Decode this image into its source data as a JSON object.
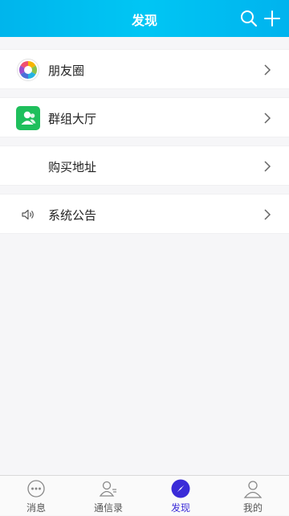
{
  "header": {
    "title": "发现"
  },
  "menu": [
    {
      "label": "朋友圈"
    },
    {
      "label": "群组大厅"
    },
    {
      "label": "购买地址"
    },
    {
      "label": "系统公告"
    }
  ],
  "tabs": [
    {
      "label": "消息"
    },
    {
      "label": "通信录"
    },
    {
      "label": "发现"
    },
    {
      "label": "我的"
    }
  ],
  "colors": {
    "header_start": "#00b5ec",
    "header_end": "#00c6f4",
    "active_tab": "#3a2bd8",
    "group_icon": "#1fbf5c"
  }
}
